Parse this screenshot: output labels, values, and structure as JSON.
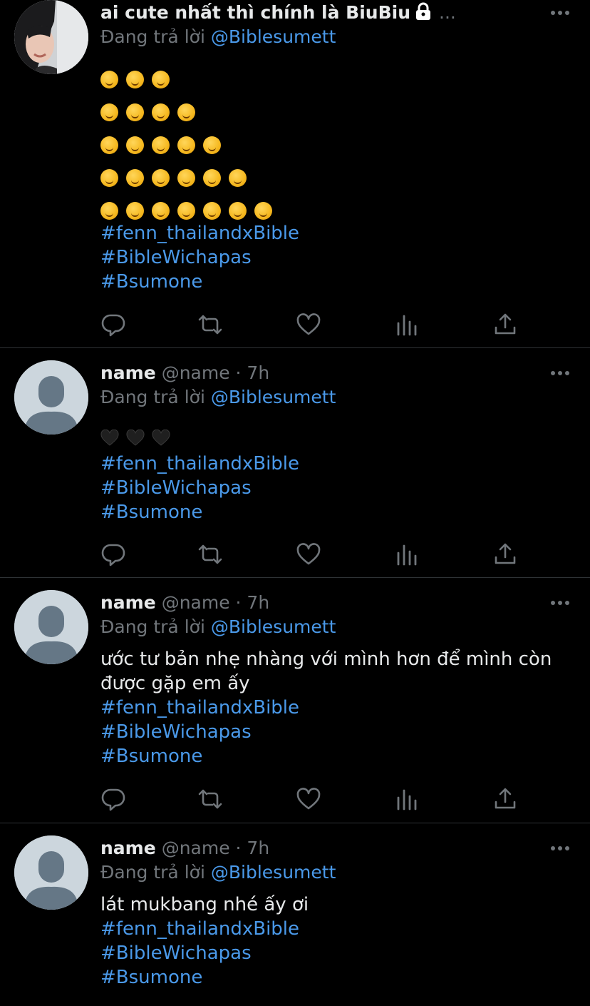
{
  "colors": {
    "background": "#000000",
    "text": "#e7e9ea",
    "muted": "#71767b",
    "link": "#4a99e9",
    "divider": "#2f3336"
  },
  "tweets": [
    {
      "display_name": "ai cute nhất thì chính là BiuBiu",
      "handle": "",
      "protected_icon": "lock-icon",
      "truncated": "...",
      "reply_label": "Đang trả lời",
      "reply_to": "@Biblesumett",
      "emoji_rows": [
        3,
        4,
        5,
        6,
        7
      ],
      "emoji_name": "drooling-face",
      "hashtags": [
        "#fenn_thailandxBible",
        "#BibleWichapas",
        "#Bsumone"
      ]
    },
    {
      "display_name": "name",
      "handle": "@name · 7h",
      "reply_label": "Đang trả lời",
      "reply_to": "@Biblesumett",
      "hearts": 3,
      "heart_name": "black-heart",
      "hashtags": [
        "#fenn_thailandxBible",
        "#BibleWichapas",
        "#Bsumone"
      ]
    },
    {
      "display_name": "name",
      "handle": "@name · 7h",
      "reply_label": "Đang trả lời",
      "reply_to": "@Biblesumett",
      "text_lines": [
        "ước tư bản nhẹ nhàng với mình hơn để mình còn",
        "được gặp em ấy"
      ],
      "hashtags": [
        "#fenn_thailandxBible",
        "#BibleWichapas",
        "#Bsumone"
      ]
    },
    {
      "display_name": "name",
      "handle": "@name · 7h",
      "reply_label": "Đang trả lời",
      "reply_to": "@Biblesumett",
      "text_lines": [
        "lát mukbang nhé ấy ơi"
      ],
      "hashtags": [
        "#fenn_thailandxBible",
        "#BibleWichapas",
        "#Bsumone"
      ]
    }
  ],
  "action_icons": [
    "reply-icon",
    "retweet-icon",
    "like-icon",
    "analytics-icon",
    "share-icon"
  ],
  "more_icon": "more-options-icon"
}
